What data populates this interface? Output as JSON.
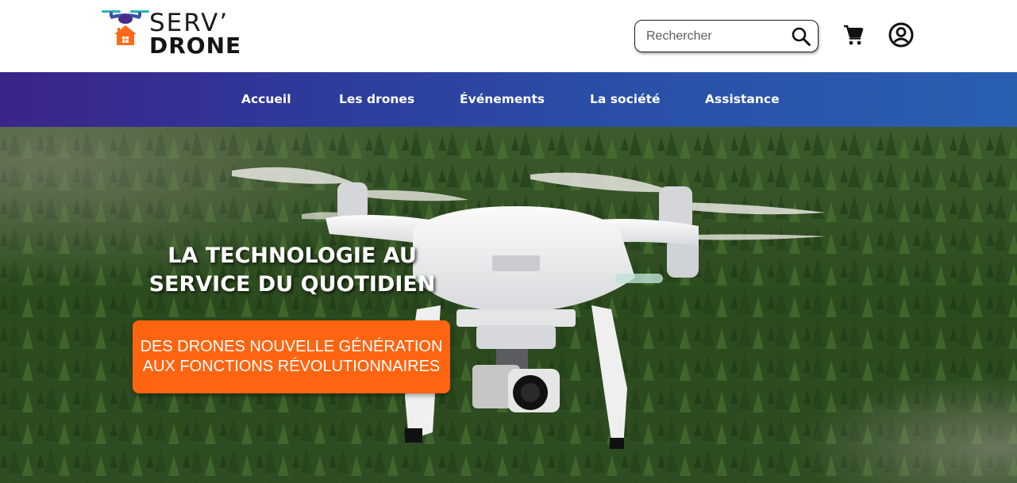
{
  "header": {
    "logo": {
      "line1": "SERV’",
      "line2": "DRONE"
    },
    "search": {
      "placeholder": "Rechercher",
      "value": ""
    },
    "icons": [
      "search-icon",
      "cart-icon",
      "account-icon"
    ]
  },
  "nav": {
    "items": [
      {
        "label": "Accueil"
      },
      {
        "label": "Les drones"
      },
      {
        "label": "Événements"
      },
      {
        "label": "La société"
      },
      {
        "label": "Assistance"
      }
    ]
  },
  "hero": {
    "title_line1": "LA TECHNOLOGIE AU",
    "title_line2": "SERVICE DU QUOTIDIEN",
    "cta_line1": "DES DRONES NOUVELLE GÉNÉRATION",
    "cta_line2": "AUX FONCTIONS RÉVOLUTIONNAIRES"
  },
  "colors": {
    "accent_orange": "#ff6410",
    "nav_gradient_start": "#3b2488",
    "nav_gradient_end": "#2a5fb0",
    "logo_blue": "#3a56a8",
    "logo_teal": "#2bb3b9"
  }
}
